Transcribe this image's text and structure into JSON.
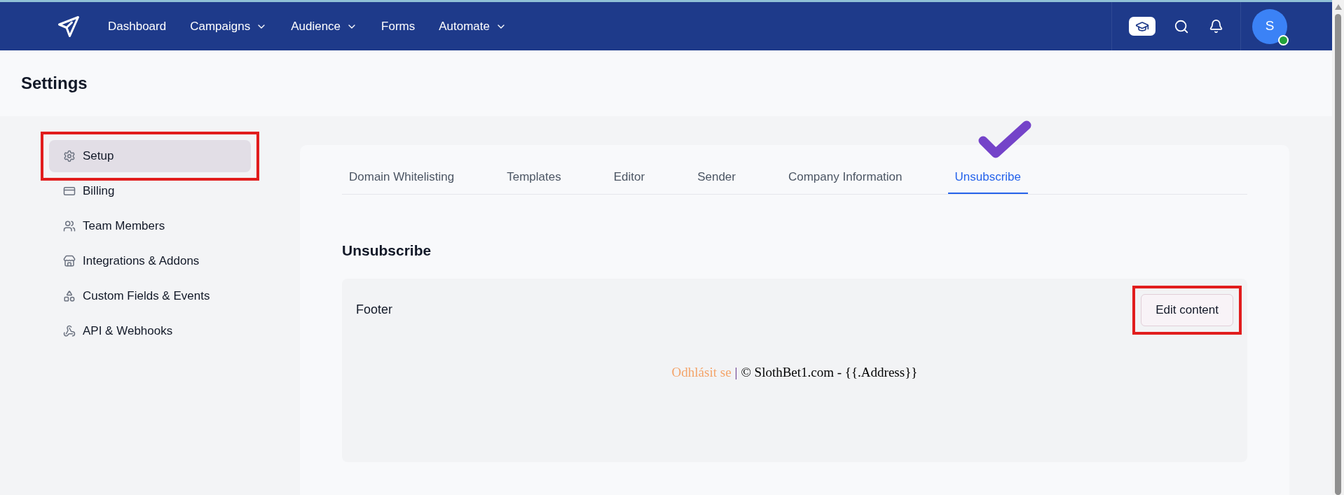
{
  "nav": {
    "items": [
      {
        "label": "Dashboard",
        "dropdown": false
      },
      {
        "label": "Campaigns",
        "dropdown": true
      },
      {
        "label": "Audience",
        "dropdown": true
      },
      {
        "label": "Forms",
        "dropdown": false
      },
      {
        "label": "Automate",
        "dropdown": true
      }
    ],
    "avatar": {
      "initial": "S",
      "online": true
    }
  },
  "page": {
    "title": "Settings"
  },
  "sidebar": {
    "items": [
      {
        "label": "Setup",
        "selected": true,
        "highlighted": true
      },
      {
        "label": "Billing",
        "selected": false,
        "highlighted": false
      },
      {
        "label": "Team Members",
        "selected": false,
        "highlighted": false
      },
      {
        "label": "Integrations & Addons",
        "selected": false,
        "highlighted": false
      },
      {
        "label": "Custom Fields & Events",
        "selected": false,
        "highlighted": false
      },
      {
        "label": "API & Webhooks",
        "selected": false,
        "highlighted": false
      }
    ]
  },
  "tabs": [
    {
      "label": "Domain Whitelisting",
      "selected": false,
      "check_mark": false
    },
    {
      "label": "Templates",
      "selected": false,
      "check_mark": false
    },
    {
      "label": "Editor",
      "selected": false,
      "check_mark": false
    },
    {
      "label": "Sender",
      "selected": false,
      "check_mark": false
    },
    {
      "label": "Company Information",
      "selected": false,
      "check_mark": false
    },
    {
      "label": "Unsubscribe",
      "selected": true,
      "check_mark": true
    }
  ],
  "section": {
    "title": "Unsubscribe",
    "footer": {
      "label": "Footer",
      "button": {
        "label": "Edit content",
        "highlighted": true
      },
      "preview": {
        "link": "Odhlásit se",
        "separator": "|",
        "text": "© SlothBet1.com - {{.Address}}"
      }
    }
  }
}
